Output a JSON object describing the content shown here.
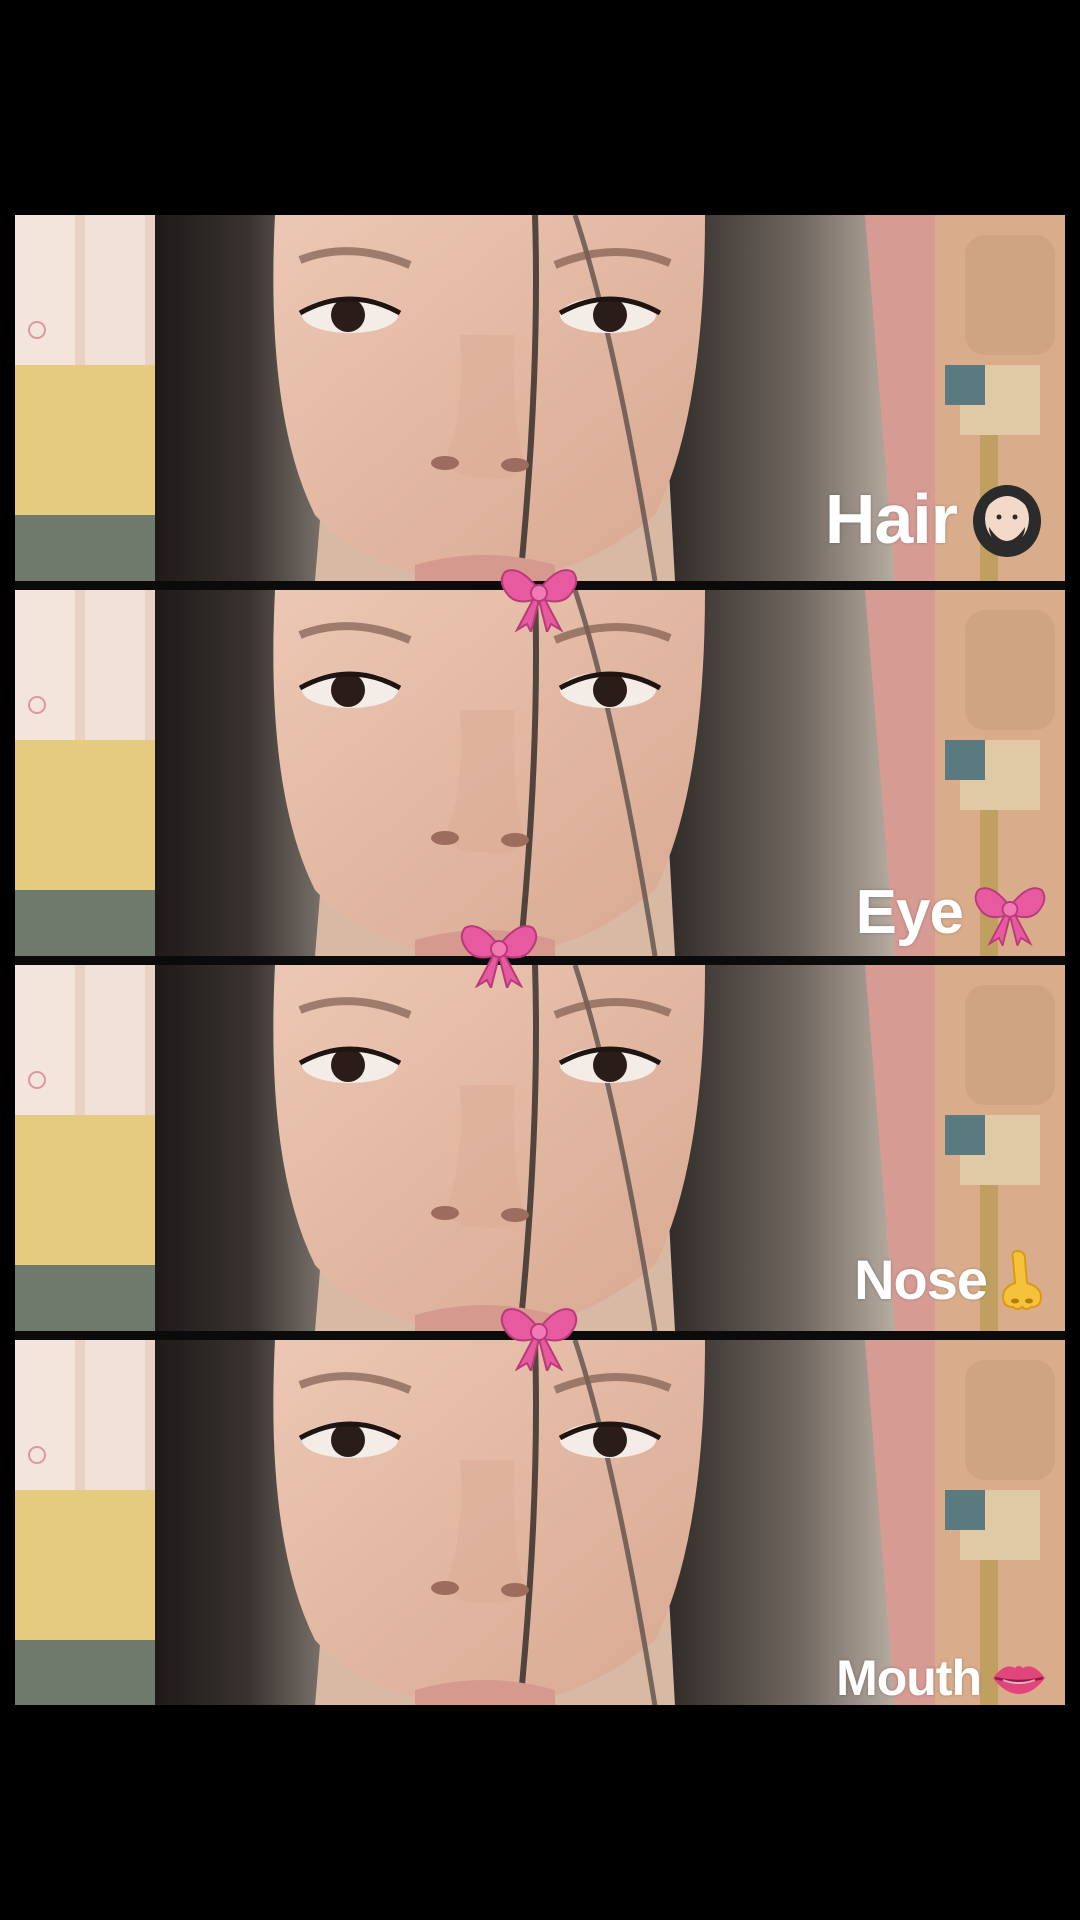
{
  "panels": [
    {
      "label": "Hair",
      "emoji": "person-with-beard-emoji"
    },
    {
      "label": "Eye",
      "emoji": "pink-bow-emoji"
    },
    {
      "label": "Nose",
      "emoji": "nose-emoji"
    },
    {
      "label": "Mouth",
      "emoji": "lips-emoji"
    }
  ],
  "colors": {
    "background": "#000000",
    "caption_text": "#ffffff",
    "bow_pink": "#e85aa0",
    "skin": "#e3b9a4",
    "hair": "#2a2523",
    "wall_pink": "#d9a49b",
    "wall_yellow": "#e3cc82"
  },
  "decorations": [
    "pink-bow-emoji",
    "pink-bow-emoji",
    "pink-bow-emoji"
  ]
}
